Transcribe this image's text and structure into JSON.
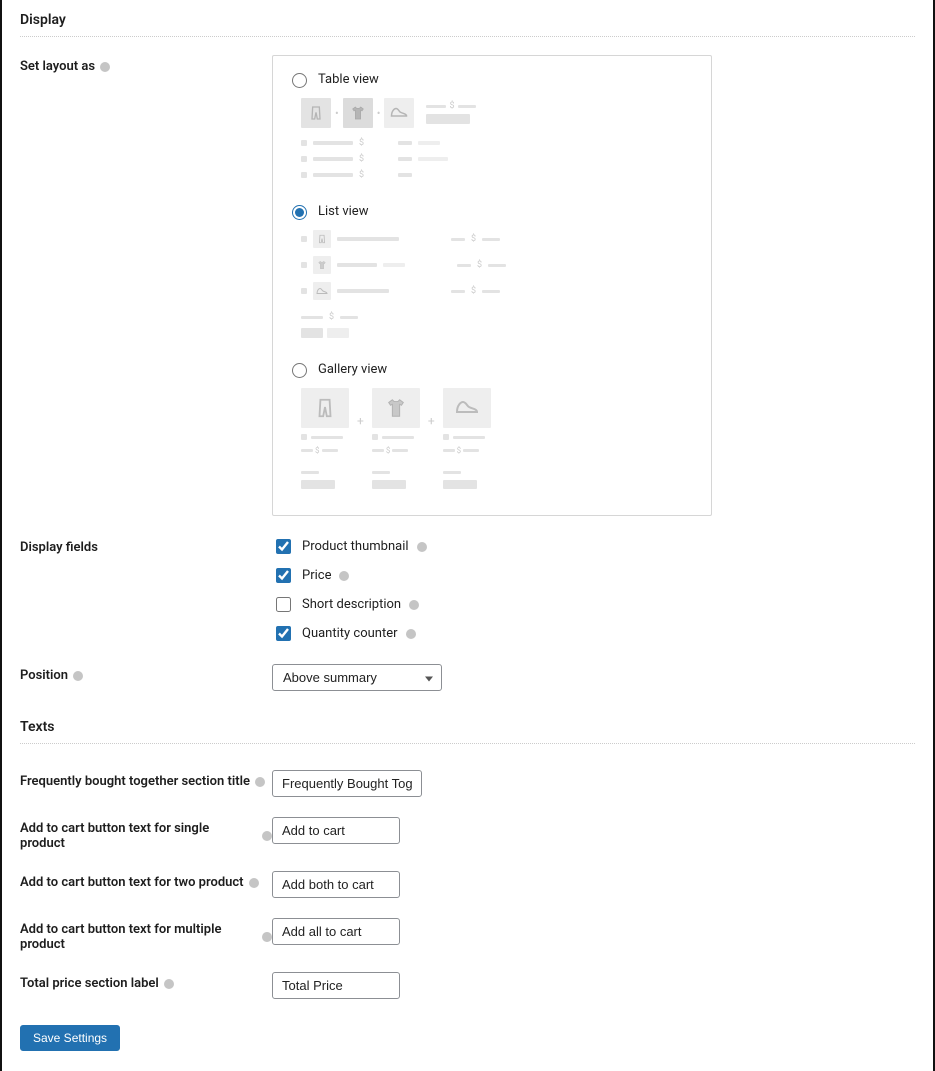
{
  "sections": {
    "display": "Display",
    "texts": "Texts"
  },
  "layout": {
    "label": "Set layout as",
    "options": {
      "table": "Table view",
      "list": "List view",
      "gallery": "Gallery view"
    },
    "selected": "list"
  },
  "display_fields": {
    "label": "Display fields",
    "items": {
      "thumbnail": {
        "label": "Product thumbnail",
        "checked": true
      },
      "price": {
        "label": "Price",
        "checked": true
      },
      "shortdesc": {
        "label": "Short description",
        "checked": false
      },
      "qty": {
        "label": "Quantity counter",
        "checked": true
      }
    }
  },
  "position": {
    "label": "Position",
    "value": "Above summary"
  },
  "texts": {
    "section_title": {
      "label": "Frequently bought together section title",
      "value": "Frequently Bought Together"
    },
    "btn_single": {
      "label": "Add to cart button text for single product",
      "value": "Add to cart"
    },
    "btn_two": {
      "label": "Add to cart button text for two product",
      "value": "Add both to cart"
    },
    "btn_multiple": {
      "label": "Add to cart button text for multiple product",
      "value": "Add all to cart"
    },
    "total_label": {
      "label": "Total price section label",
      "value": "Total Price"
    }
  },
  "buttons": {
    "save": "Save Settings"
  }
}
